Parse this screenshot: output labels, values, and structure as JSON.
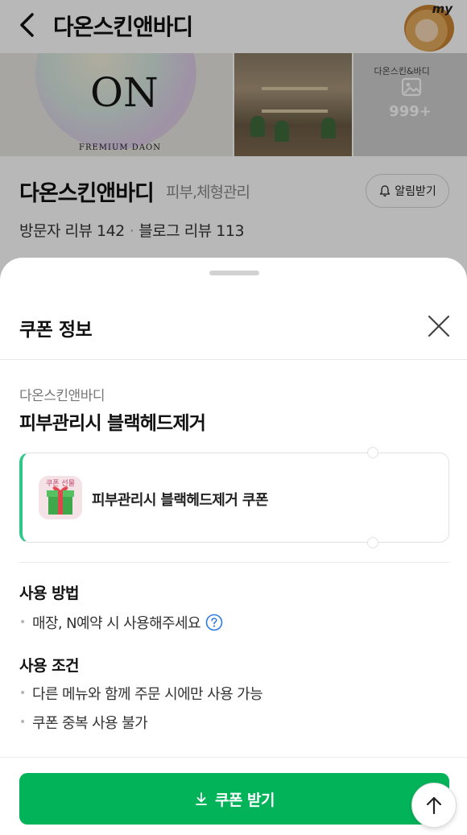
{
  "background": {
    "header": {
      "title": "다온스킨앤바디",
      "avatar_badge": "my"
    },
    "gallery": {
      "logo_text": "ON",
      "logo_subtext": "FREMIUM DAON",
      "sign_text": "다온스킨&바디",
      "photo_count": "999+"
    },
    "store": {
      "name": "다온스킨앤바디",
      "category": "피부,체형관리",
      "alarm_label": "알림받기",
      "visitor_reviews": "방문자 리뷰 142",
      "blog_reviews": "블로그 리뷰 113",
      "separator": "·"
    }
  },
  "sheet": {
    "title": "쿠폰 정보",
    "coupon": {
      "store_name": "다온스킨앤바디",
      "name": "피부관리시 블랙헤드제거",
      "ticket_label": "피부관리시 블랙헤드제거 쿠폰",
      "gift_badge": "쿠폰 선물"
    },
    "usage": {
      "heading": "사용 방법",
      "items": [
        "매장, N예약 시 사용해주세요"
      ]
    },
    "conditions": {
      "heading": "사용 조건",
      "items": [
        "다른 메뉴와 함께 주문 시에만 사용 가능",
        "쿠폰 중복 사용 불가"
      ]
    },
    "cta_label": "쿠폰 받기"
  },
  "colors": {
    "accent_green": "#03b35a",
    "ticket_stripe": "#2ec98a",
    "help_blue": "#2e7be0"
  },
  "icons": [
    "back-icon",
    "photo-icon",
    "bell-icon",
    "close-icon",
    "gift-icon",
    "help-icon",
    "download-icon",
    "arrow-up-icon"
  ]
}
